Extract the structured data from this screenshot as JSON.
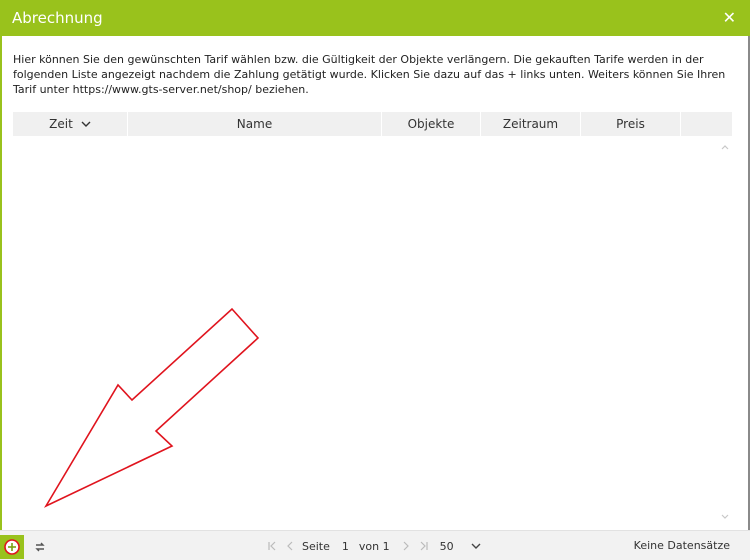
{
  "dialog": {
    "title": "Abrechnung",
    "close_icon": "close-icon"
  },
  "description": "Hier können Sie den gewünschten Tarif wählen bzw. die Gültigkeit der Objekte verlängern. Die gekauften Tarife werden in der folgenden Liste angezeigt nachdem die Zahlung getätigt wurde. Klicken Sie dazu auf das + links unten. Weiters können Sie Ihren Tarif unter https://www.gts-server.net/shop/ beziehen.",
  "grid": {
    "columns": [
      "Zeit",
      "Name",
      "Objekte",
      "Zeitraum",
      "Preis"
    ],
    "sort_column": "Zeit",
    "sort_direction": "descending",
    "rows": []
  },
  "toolbar": {
    "add_icon": "plus-icon",
    "refresh_icon": "refresh-icon",
    "page_label": "Seite",
    "page_value": "1",
    "of_label": "von 1",
    "page_size": "50",
    "status": "Keine Datensätze"
  },
  "colors": {
    "accent": "#99c21c",
    "annotation_arrow": "#e0141e",
    "header_bg": "#f0f0f0",
    "toolbar_bg": "#f2f2f2"
  }
}
